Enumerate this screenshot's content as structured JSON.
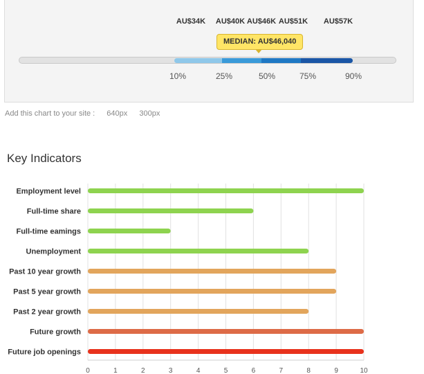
{
  "salary": {
    "values": [
      "AU$34K",
      "AU$40K",
      "AU$46K",
      "AU$51K",
      "AU$57K"
    ],
    "median_label": "MEDIAN: AU$46,040",
    "percentiles": [
      "10%",
      "25%",
      "50%",
      "75%",
      "90%"
    ],
    "colors": [
      "#8fc8ea",
      "#3a9ad9",
      "#1f78c4",
      "#1a56a6"
    ]
  },
  "embed": {
    "label": "Add this chart to your site :",
    "sizes": [
      "640px",
      "300px"
    ]
  },
  "section_title": "Key Indicators",
  "chart_data": {
    "type": "bar",
    "orientation": "horizontal",
    "title": "",
    "xlabel": "",
    "ylabel": "",
    "xlim": [
      0,
      10
    ],
    "grid": true,
    "categories": [
      "Employment level",
      "Full-time share",
      "Full-time eamings",
      "Unemployment",
      "Past 10 year growth",
      "Past 5 year growth",
      "Past 2 year growth",
      "Future growth",
      "Future job openings"
    ],
    "values": [
      10,
      6,
      3,
      8,
      9,
      9,
      8,
      10,
      10
    ],
    "colors": [
      "#8ed34f",
      "#8ed34f",
      "#8ed34f",
      "#8ed34f",
      "#e2a55c",
      "#e2a55c",
      "#e2a55c",
      "#dd6b47",
      "#e8321c"
    ],
    "ticks": [
      "0",
      "1",
      "2",
      "3",
      "4",
      "5",
      "6",
      "7",
      "8",
      "9",
      "10"
    ]
  }
}
